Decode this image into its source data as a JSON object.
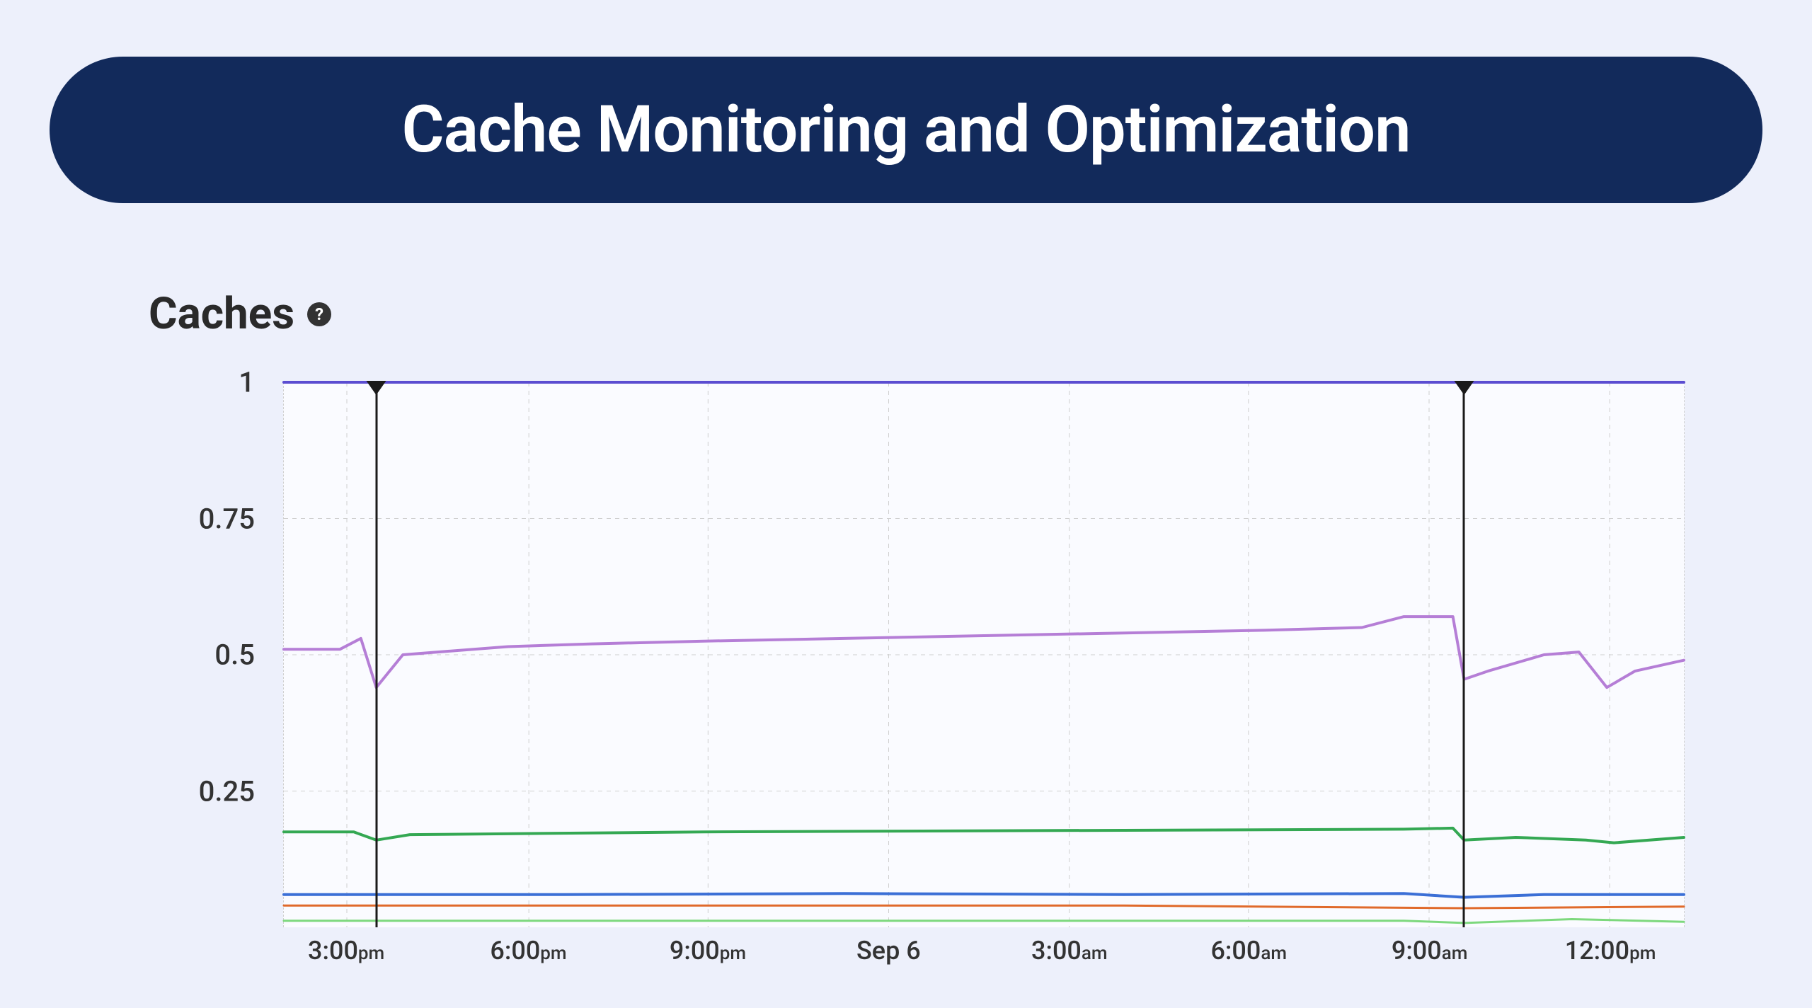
{
  "banner": {
    "title": "Cache Monitoring and Optimization"
  },
  "section": {
    "title": "Caches",
    "help_icon": "?"
  },
  "chart_data": {
    "type": "line",
    "title": "",
    "xlabel": "",
    "ylabel": "",
    "ylim": [
      0,
      1
    ],
    "y_ticks": [
      0.25,
      0.5,
      0.75,
      1
    ],
    "x_ticks": [
      {
        "label": "3:00",
        "suffix": "pm",
        "pos": 0.045
      },
      {
        "label": "6:00",
        "suffix": "pm",
        "pos": 0.175
      },
      {
        "label": "9:00",
        "suffix": "pm",
        "pos": 0.303
      },
      {
        "label": "Sep 6",
        "suffix": "",
        "pos": 0.432
      },
      {
        "label": "3:00",
        "suffix": "am",
        "pos": 0.561
      },
      {
        "label": "6:00",
        "suffix": "am",
        "pos": 0.689
      },
      {
        "label": "9:00",
        "suffix": "am",
        "pos": 0.818
      },
      {
        "label": "12:00",
        "suffix": "pm",
        "pos": 0.947
      }
    ],
    "markers": [
      0.066,
      0.843
    ],
    "series": [
      {
        "name": "series-top",
        "color": "#5b4dd1",
        "width": 4,
        "values": [
          [
            0,
            1.0
          ],
          [
            1,
            1.0
          ]
        ]
      },
      {
        "name": "series-mid",
        "color": "#b57ed6",
        "width": 4,
        "values": [
          [
            0.0,
            0.51
          ],
          [
            0.04,
            0.51
          ],
          [
            0.055,
            0.53
          ],
          [
            0.066,
            0.44
          ],
          [
            0.085,
            0.5
          ],
          [
            0.11,
            0.505
          ],
          [
            0.16,
            0.515
          ],
          [
            0.22,
            0.52
          ],
          [
            0.3,
            0.525
          ],
          [
            0.4,
            0.53
          ],
          [
            0.5,
            0.535
          ],
          [
            0.6,
            0.54
          ],
          [
            0.7,
            0.545
          ],
          [
            0.77,
            0.55
          ],
          [
            0.8,
            0.57
          ],
          [
            0.835,
            0.57
          ],
          [
            0.843,
            0.455
          ],
          [
            0.86,
            0.47
          ],
          [
            0.9,
            0.5
          ],
          [
            0.925,
            0.505
          ],
          [
            0.945,
            0.44
          ],
          [
            0.965,
            0.47
          ],
          [
            1.0,
            0.49
          ]
        ]
      },
      {
        "name": "series-green",
        "color": "#34a853",
        "width": 4,
        "values": [
          [
            0.0,
            0.175
          ],
          [
            0.05,
            0.175
          ],
          [
            0.066,
            0.16
          ],
          [
            0.09,
            0.17
          ],
          [
            0.3,
            0.175
          ],
          [
            0.6,
            0.178
          ],
          [
            0.8,
            0.18
          ],
          [
            0.835,
            0.182
          ],
          [
            0.843,
            0.16
          ],
          [
            0.88,
            0.165
          ],
          [
            0.93,
            0.16
          ],
          [
            0.95,
            0.155
          ],
          [
            1.0,
            0.165
          ]
        ]
      },
      {
        "name": "series-blue",
        "color": "#3b6fd6",
        "width": 4,
        "values": [
          [
            0.0,
            0.06
          ],
          [
            0.2,
            0.06
          ],
          [
            0.4,
            0.062
          ],
          [
            0.6,
            0.06
          ],
          [
            0.8,
            0.062
          ],
          [
            0.843,
            0.055
          ],
          [
            0.9,
            0.06
          ],
          [
            1.0,
            0.06
          ]
        ]
      },
      {
        "name": "series-orange",
        "color": "#e06a2b",
        "width": 3,
        "values": [
          [
            0.0,
            0.04
          ],
          [
            0.3,
            0.04
          ],
          [
            0.6,
            0.04
          ],
          [
            0.843,
            0.035
          ],
          [
            1.0,
            0.038
          ]
        ]
      },
      {
        "name": "series-lightgreen",
        "color": "#7dd87d",
        "width": 3,
        "values": [
          [
            0.0,
            0.012
          ],
          [
            0.3,
            0.012
          ],
          [
            0.6,
            0.012
          ],
          [
            0.8,
            0.012
          ],
          [
            0.843,
            0.008
          ],
          [
            0.92,
            0.015
          ],
          [
            1.0,
            0.01
          ]
        ]
      }
    ]
  }
}
